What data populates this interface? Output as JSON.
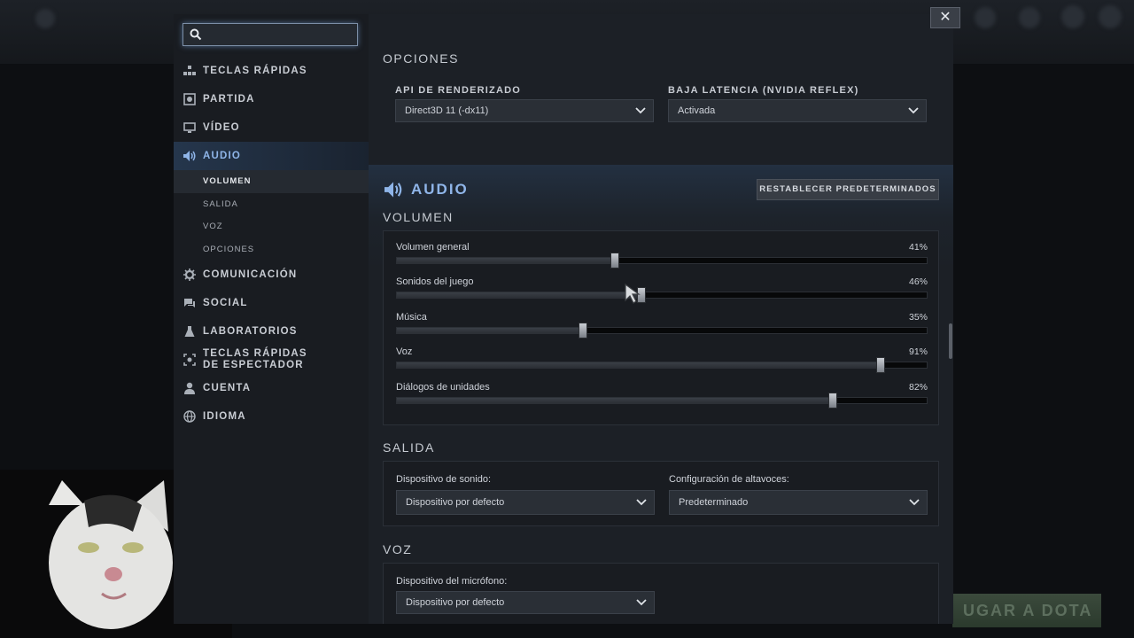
{
  "sidebar": {
    "search": {
      "placeholder": ""
    },
    "items": [
      {
        "label": "TECLAS RÁPIDAS",
        "icon": "hotkeys-icon"
      },
      {
        "label": "PARTIDA",
        "icon": "game-icon"
      },
      {
        "label": "VÍDEO",
        "icon": "monitor-icon"
      },
      {
        "label": "AUDIO",
        "icon": "speaker-icon",
        "active": true,
        "subitems": [
          {
            "label": "VOLUMEN",
            "active": true
          },
          {
            "label": "SALIDA"
          },
          {
            "label": "VOZ"
          },
          {
            "label": "OPCIONES"
          }
        ]
      },
      {
        "label": "COMUNICACIÓN",
        "icon": "gear-icon"
      },
      {
        "label": "SOCIAL",
        "icon": "chat-icon"
      },
      {
        "label": "LABORATORIOS",
        "icon": "flask-icon"
      },
      {
        "label": "TECLAS RÁPIDAS DE ESPECTADOR",
        "icon": "spectator-icon"
      },
      {
        "label": "CUENTA",
        "icon": "user-icon"
      },
      {
        "label": "IDIOMA",
        "icon": "globe-icon"
      }
    ]
  },
  "video_options": {
    "title": "OPCIONES",
    "render_api": {
      "label": "API DE RENDERIZADO",
      "value": "Direct3D 11 (-dx11)"
    },
    "low_latency": {
      "label": "BAJA LATENCIA (NVIDIA REFLEX)",
      "value": "Activada"
    }
  },
  "audio": {
    "title": "AUDIO",
    "reset_label": "RESTABLECER PREDETERMINADOS",
    "volume": {
      "title": "VOLUMEN",
      "sliders": [
        {
          "label": "Volumen general",
          "value_text": "41%",
          "value": 41
        },
        {
          "label": "Sonidos del juego",
          "value_text": "46%",
          "value": 46
        },
        {
          "label": "Música",
          "value_text": "35%",
          "value": 35
        },
        {
          "label": "Voz",
          "value_text": "91%",
          "value": 91
        },
        {
          "label": "Diálogos de unidades",
          "value_text": "82%",
          "value": 82
        }
      ]
    },
    "output": {
      "title": "SALIDA",
      "device": {
        "label": "Dispositivo de sonido:",
        "value": "Dispositivo por defecto"
      },
      "speakers": {
        "label": "Configuración de altavoces:",
        "value": "Predeterminado"
      }
    },
    "voice": {
      "title": "VOZ",
      "mic": {
        "label": "Dispositivo del micrófono:",
        "value": "Dispositivo por defecto"
      }
    }
  },
  "close_label": "✕",
  "background": {
    "play_button_text": "UGAR A DOTA"
  },
  "colors": {
    "accent": "#8fb5e8",
    "panel": "#1c2026",
    "sidebar": "#191c21"
  }
}
